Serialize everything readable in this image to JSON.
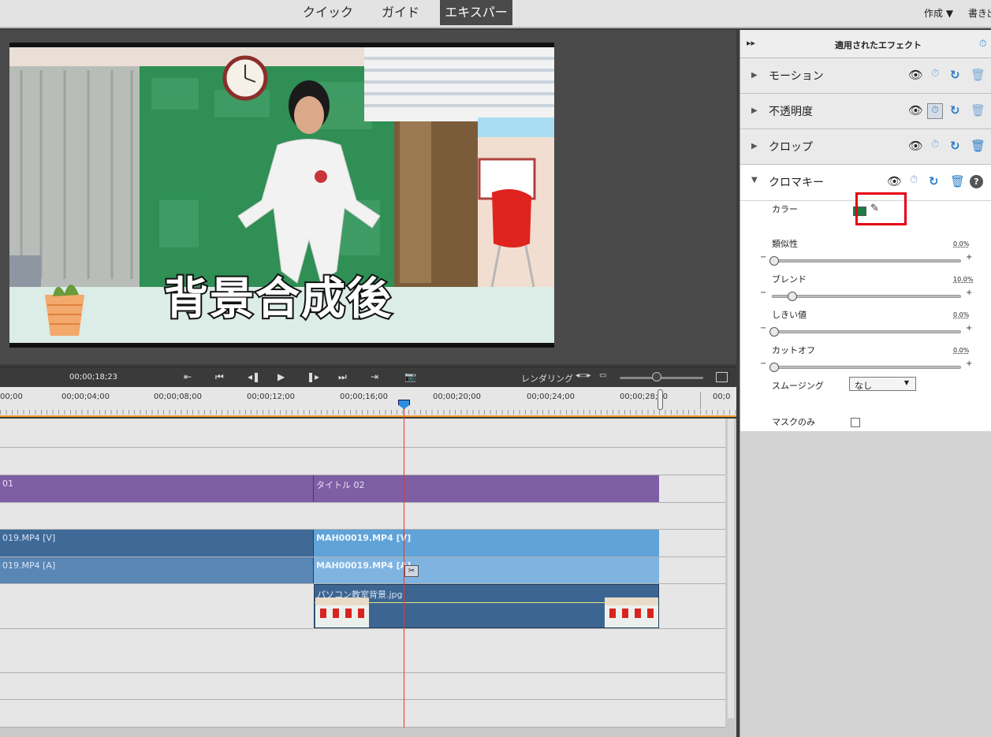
{
  "top_bar": {
    "modes": [
      "クイック",
      "ガイド",
      "エキスパート"
    ],
    "active_mode": "エキスパート",
    "create_menu": "作成 ▼",
    "export_menu": "書き出"
  },
  "monitor": {
    "overlay_text": "背景合成後"
  },
  "transport": {
    "timecode": "00;00;18;23",
    "render_label": "レンダリング"
  },
  "ruler": {
    "labels": [
      "00;00",
      "00;00;04;00",
      "00;00;08;00",
      "00;00;12;00",
      "00;00;16;00",
      "00;00;20;00",
      "00;00;24;00",
      "00;00;28;00",
      "00;0"
    ]
  },
  "timeline": {
    "title_clip_left": "01",
    "title_clip_right": "タイトル 02",
    "video_clip_left": "019.MP4 [V]",
    "video_clip_right": "MAH00019.MP4 [V]",
    "audio_clip_left": "019.MP4 [A]",
    "audio_clip_right": "MAH00019.MP4 [A]",
    "image_clip": "パソコン教室背景.jpg"
  },
  "panel": {
    "title": "適用されたエフェクト",
    "effects": [
      "モーション",
      "不透明度",
      "クロップ",
      "クロマキー"
    ],
    "chroma": {
      "color_label": "カラー",
      "key_color": "#1f7a45",
      "similarity_label": "類似性",
      "similarity_value": "0.0%",
      "blend_label": "ブレンド",
      "blend_value": "10.0%",
      "threshold_label": "しきい値",
      "threshold_value": "0.0%",
      "cutoff_label": "カットオフ",
      "cutoff_value": "0.0%",
      "smoothing_label": "スムージング",
      "smoothing_value": "なし",
      "mask_only_label": "マスクのみ"
    }
  },
  "colors": {
    "title_clip": "#7e5ea5",
    "video_clip": "#3f6a98",
    "video_clip_selected": "#5fa3d8",
    "accent_blue": "#2b7cc9",
    "highlight_red": "#e60012"
  }
}
